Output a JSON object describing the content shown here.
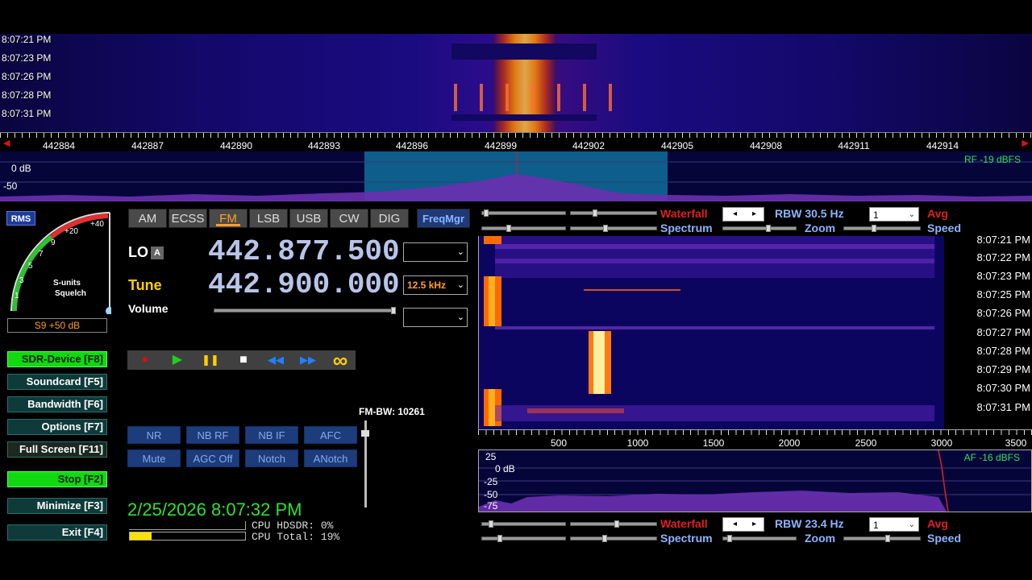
{
  "rf_waterfall": {
    "timestamps": [
      "8:07:21 PM",
      "8:07:23 PM",
      "8:07:26 PM",
      "8:07:28 PM",
      "8:07:31 PM"
    ]
  },
  "rf_axis": {
    "labels": [
      "442884",
      "442887",
      "442890",
      "442893",
      "442896",
      "442899",
      "442902",
      "442905",
      "442908",
      "442911",
      "442914"
    ]
  },
  "rf_spectrum": {
    "db_labels": [
      "0 dB",
      "-50"
    ],
    "level": "RF -19 dBFS"
  },
  "smeter": {
    "rms_label": "RMS",
    "scale": [
      "1",
      "3",
      "5",
      "7",
      "9",
      "+20",
      "+40"
    ],
    "caption_line1": "S-units",
    "caption_line2": "Squelch",
    "reading": "S9 +50 dB"
  },
  "left_buttons": [
    {
      "label": "SDR-Device [F8]",
      "active": true
    },
    {
      "label": "Soundcard [F5]",
      "active": false
    },
    {
      "label": "Bandwidth [F6]",
      "active": false
    },
    {
      "label": "Options [F7]",
      "active": false
    },
    {
      "label": "Full Screen [F11]",
      "active": false
    },
    {
      "label": "Stop [F2]",
      "active": true
    },
    {
      "label": "Minimize [F3]",
      "active": false
    },
    {
      "label": "Exit [F4]",
      "active": false
    }
  ],
  "modes": [
    "AM",
    "ECSS",
    "FM",
    "LSB",
    "USB",
    "CW",
    "DIG"
  ],
  "active_mode": "FM",
  "freqmgr": "FreqMgr",
  "lo": {
    "label": "LO",
    "badge": "A",
    "value": "442.877.500"
  },
  "tune": {
    "label": "Tune",
    "value": "442.900.000",
    "step": "12.5 kHz"
  },
  "volume": {
    "label": "Volume",
    "level": 0.97
  },
  "transport": {
    "record": "●",
    "play": "▶",
    "pause": "❚❚",
    "stop": "■",
    "rewind": "◀◀",
    "forward": "▶▶",
    "loop": "∞"
  },
  "fm_bw": "FM-BW: 10261",
  "dsp_row1": [
    "NR",
    "NB RF",
    "NB IF",
    "AFC"
  ],
  "dsp_row2": [
    "Mute",
    "AGC Off",
    "Notch",
    "ANotch"
  ],
  "datetime": "2/25/2026 8:07:32 PM",
  "cpu": {
    "hdsdr": "CPU HDSDR: 0%",
    "total": "CPU Total: 19%"
  },
  "top_controls": {
    "waterfall": "Waterfall",
    "spectrum": "Spectrum",
    "rbw": "RBW 30.5 Hz",
    "zoom": "Zoom",
    "avg_value": "1",
    "avg": "Avg",
    "speed": "Speed"
  },
  "af_waterfall": {
    "timestamps": [
      "8:07:21 PM",
      "8:07:22 PM",
      "8:07:23 PM",
      "8:07:25 PM",
      "8:07:26 PM",
      "8:07:27 PM",
      "8:07:28 PM",
      "8:07:29 PM",
      "8:07:30 PM",
      "8:07:31 PM"
    ]
  },
  "af_axis": {
    "labels": [
      "500",
      "1000",
      "1500",
      "2000",
      "2500",
      "3000",
      "3500"
    ]
  },
  "af_spectrum": {
    "db_labels": [
      "25",
      "0 dB",
      "-25",
      "-50",
      "-75"
    ],
    "level": "AF -16 dBFS"
  },
  "bottom_controls": {
    "waterfall": "Waterfall",
    "spectrum": "Spectrum",
    "rbw": "RBW 23.4 Hz",
    "zoom": "Zoom",
    "avg_value": "1",
    "avg": "Avg",
    "speed": "Speed"
  },
  "colors": {
    "accent_green": "#12d812",
    "mode_orange": "#ffa028",
    "freq_blue": "#b8c4e8",
    "red": "#e02020"
  }
}
